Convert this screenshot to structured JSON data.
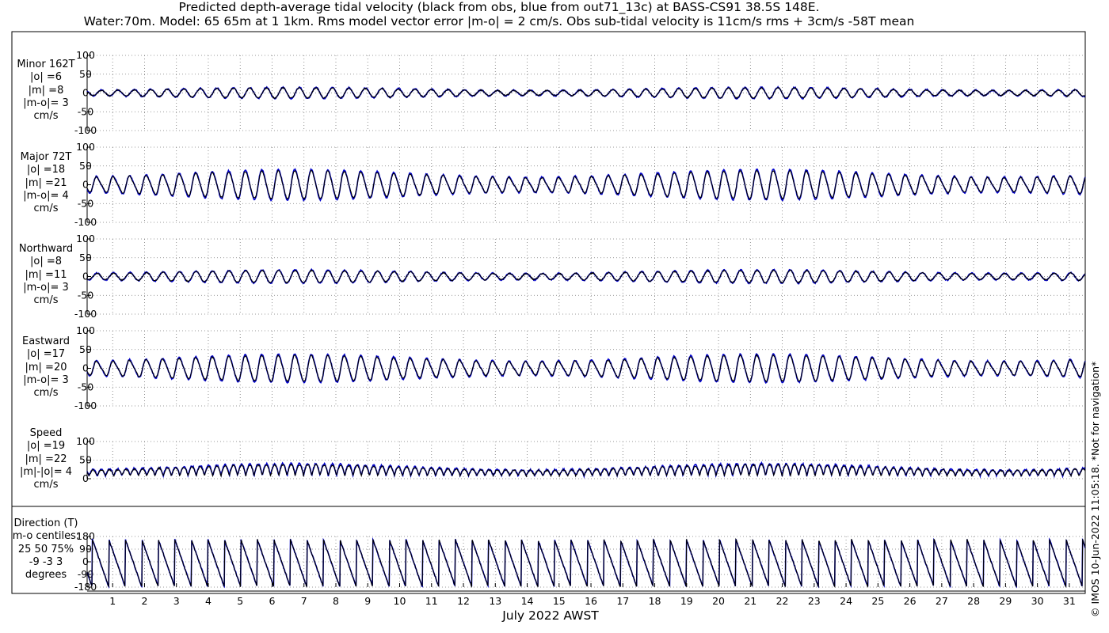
{
  "title_line1": "Predicted depth-average tidal velocity (black from obs, blue from out71_13c) at BASS-CS91 38.5S 148E.",
  "title_line2": "Water:70m. Model: 65 65m at 1 1km. Rms model vector error |m-o| = 2 cm/s. Obs sub-tidal velocity is 11cm/s rms + 3cm/s -58T mean",
  "xlabel": "July 2022 AWST",
  "credit": "© IMOS 10-Jun-2022 11:05:18. *Not for navigation*",
  "colors": {
    "obs": "#000000",
    "model": "#0000cc",
    "grid": "#777777"
  },
  "panels": [
    {
      "id": "minor",
      "label_lines": [
        "Minor 162T",
        "|o| =6",
        "|m| =8",
        "|m-o|= 3",
        "cm/s"
      ]
    },
    {
      "id": "major",
      "label_lines": [
        "Major 72T",
        "|o| =18",
        "|m| =21",
        "|m-o|= 4",
        "cm/s"
      ]
    },
    {
      "id": "north",
      "label_lines": [
        "Northward",
        "|o| =8",
        "|m| =11",
        "|m-o|= 3",
        "cm/s"
      ]
    },
    {
      "id": "east",
      "label_lines": [
        "Eastward",
        "|o| =17",
        "|m| =20",
        "|m-o|= 3",
        "cm/s"
      ]
    },
    {
      "id": "speed",
      "label_lines": [
        "Speed",
        "|o| =19",
        "|m| =22",
        "|m|-|o|= 4",
        "cm/s"
      ]
    },
    {
      "id": "direction",
      "label_lines": [
        "Direction (T)",
        "m-o centiles:",
        "25  50  75%",
        "-9 -3  3",
        "degrees"
      ]
    }
  ],
  "chart_data": [
    {
      "type": "line",
      "title": "Minor 162T",
      "ylabel": "cm/s",
      "ylim": [
        -100,
        100
      ],
      "yticks": [
        "100",
        "50",
        "0",
        "-50",
        "-100"
      ],
      "grid": true,
      "series": [
        {
          "name": "obs",
          "amplitude": 6
        },
        {
          "name": "model",
          "amplitude": 8
        }
      ]
    },
    {
      "type": "line",
      "title": "Major 72T",
      "ylabel": "cm/s",
      "ylim": [
        -100,
        100
      ],
      "yticks": [
        "100",
        "50",
        "0",
        "-50",
        "-100"
      ],
      "grid": true,
      "series": [
        {
          "name": "obs",
          "amplitude": 18
        },
        {
          "name": "model",
          "amplitude": 21
        }
      ]
    },
    {
      "type": "line",
      "title": "Northward",
      "ylabel": "cm/s",
      "ylim": [
        -100,
        100
      ],
      "yticks": [
        "100",
        "50",
        "0",
        "-50",
        "-100"
      ],
      "grid": true,
      "series": [
        {
          "name": "obs",
          "amplitude": 8
        },
        {
          "name": "model",
          "amplitude": 11
        }
      ]
    },
    {
      "type": "line",
      "title": "Eastward",
      "ylabel": "cm/s",
      "ylim": [
        -100,
        100
      ],
      "yticks": [
        "100",
        "50",
        "0",
        "-50",
        "-100"
      ],
      "grid": true,
      "series": [
        {
          "name": "obs",
          "amplitude": 17
        },
        {
          "name": "model",
          "amplitude": 20
        }
      ]
    },
    {
      "type": "line",
      "title": "Speed",
      "ylabel": "cm/s",
      "ylim": [
        0,
        100
      ],
      "yticks": [
        "100",
        "50",
        "0"
      ],
      "grid": true,
      "series": [
        {
          "name": "obs",
          "mean": 19
        },
        {
          "name": "model",
          "mean": 22
        }
      ]
    },
    {
      "type": "line",
      "title": "Direction (T)",
      "ylabel": "degrees",
      "ylim": [
        -180,
        180
      ],
      "yticks": [
        "180",
        "90",
        "0",
        "-90",
        "-180"
      ],
      "grid": true,
      "series": [
        {
          "name": "obs"
        },
        {
          "name": "model"
        }
      ]
    }
  ],
  "x_axis": {
    "label": "July 2022 AWST",
    "day_range": [
      0.2,
      31.5
    ],
    "ticks": [
      "1",
      "2",
      "3",
      "4",
      "5",
      "6",
      "7",
      "8",
      "9",
      "10",
      "11",
      "12",
      "13",
      "14",
      "15",
      "16",
      "17",
      "18",
      "19",
      "20",
      "21",
      "22",
      "23",
      "24",
      "25",
      "26",
      "27",
      "28",
      "29",
      "30",
      "31"
    ]
  }
}
